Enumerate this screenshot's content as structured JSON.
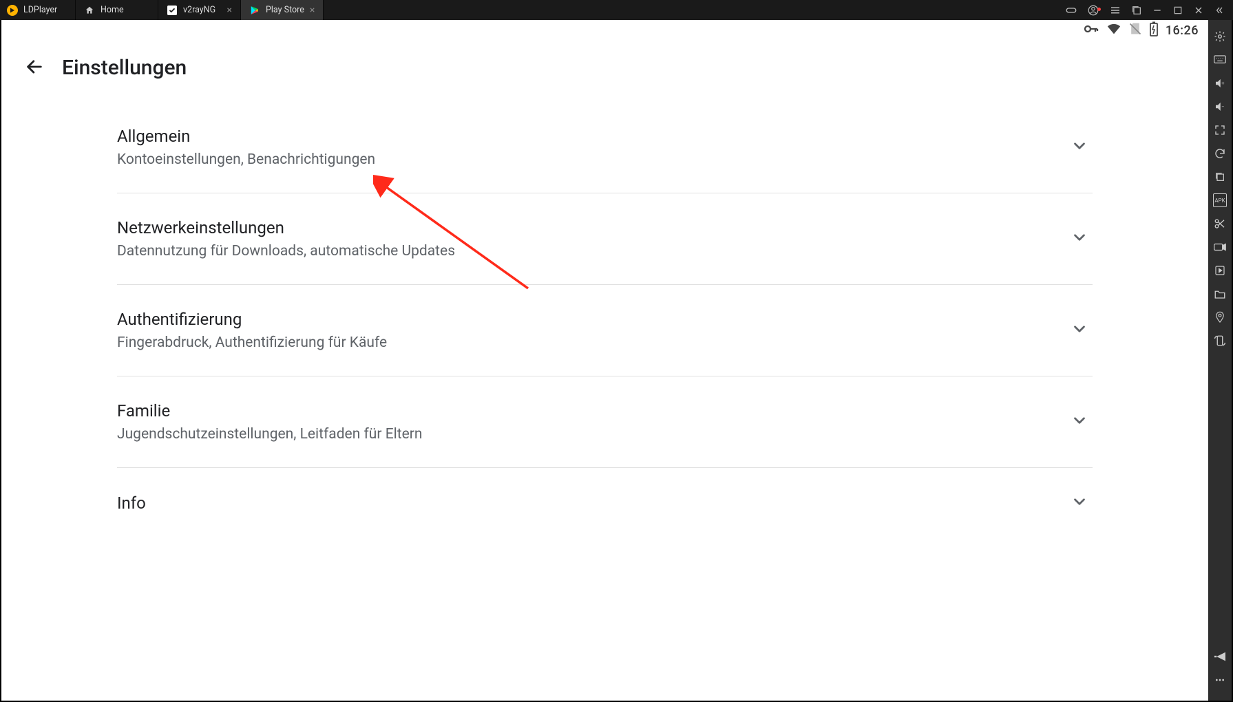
{
  "emulator": {
    "brand": "LDPlayer",
    "tabs": [
      {
        "label": "Home",
        "icon": "home-icon"
      },
      {
        "label": "v2rayNG",
        "icon": "checkbox-icon"
      },
      {
        "label": "Play Store",
        "icon": "play-icon",
        "active": true
      }
    ]
  },
  "statusbar": {
    "time": "16:26"
  },
  "page": {
    "title": "Einstellungen"
  },
  "settings": [
    {
      "title": "Allgemein",
      "subtitle": "Kontoeinstellungen, Benachrichtigungen"
    },
    {
      "title": "Netzwerkeinstellungen",
      "subtitle": "Datennutzung für Downloads, automatische Updates"
    },
    {
      "title": "Authentifizierung",
      "subtitle": "Fingerabdruck, Authentifizierung für Käufe"
    },
    {
      "title": "Familie",
      "subtitle": "Jugendschutzeinstellungen, Leitfaden für Eltern"
    },
    {
      "title": "Info",
      "subtitle": ""
    }
  ]
}
